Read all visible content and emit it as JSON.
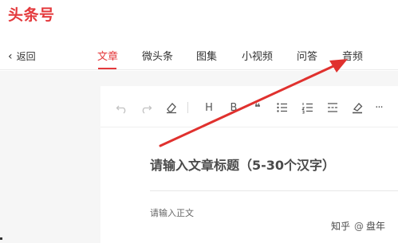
{
  "logo": "头条号",
  "back_label": "返回",
  "tabs": [
    {
      "label": "文章",
      "active": true
    },
    {
      "label": "微头条",
      "active": false
    },
    {
      "label": "图集",
      "active": false
    },
    {
      "label": "小视频",
      "active": false
    },
    {
      "label": "问答",
      "active": false
    },
    {
      "label": "音频",
      "active": false
    }
  ],
  "toolbar": {
    "tools": [
      "undo-icon",
      "redo-icon",
      "eraser-icon",
      "heading-icon",
      "bold-icon",
      "quote-icon",
      "bullet-list-icon",
      "numbered-list-icon",
      "divider-icon",
      "highlight-icon",
      "more-icon"
    ],
    "heading_label": "H",
    "bold_label": "B",
    "quote_label": "❝",
    "more_label": "···"
  },
  "editor": {
    "title_placeholder": "请输入文章标题（5-30个汉字）",
    "body_placeholder": "请输入正文"
  },
  "watermark": {
    "site": "知乎",
    "at": "@",
    "author": "盘年"
  },
  "colors": {
    "accent": "#e4393c",
    "annotation_arrow": "#e0312e"
  }
}
